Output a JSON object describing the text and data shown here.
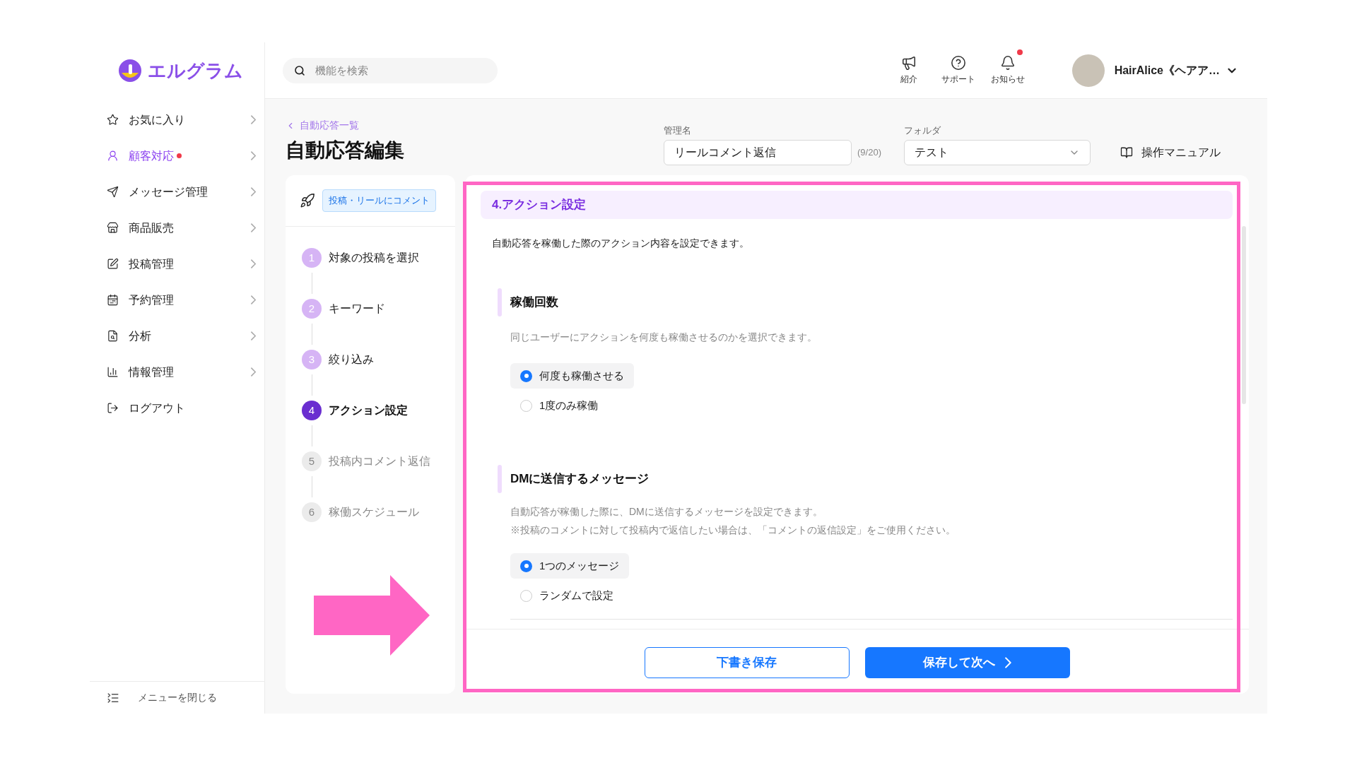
{
  "logo": {
    "text": "エルグラム"
  },
  "search": {
    "placeholder": "機能を検索"
  },
  "header_actions": [
    {
      "kind": "megaphone",
      "label": "紹介",
      "badge": false
    },
    {
      "kind": "help",
      "label": "サポート",
      "badge": false
    },
    {
      "kind": "bell",
      "label": "お知らせ",
      "badge": true
    }
  ],
  "account": {
    "name": "HairAlice《ヘアア…"
  },
  "sidebar": {
    "items": [
      {
        "label": "お気に入り",
        "selected": false,
        "dot": false,
        "submenu": true
      },
      {
        "label": "顧客対応",
        "selected": true,
        "dot": true,
        "submenu": true
      },
      {
        "label": "メッセージ管理",
        "selected": false,
        "dot": false,
        "submenu": true
      },
      {
        "label": "商品販売",
        "selected": false,
        "dot": false,
        "submenu": true
      },
      {
        "label": "投稿管理",
        "selected": false,
        "dot": false,
        "submenu": true
      },
      {
        "label": "予約管理",
        "selected": false,
        "dot": false,
        "submenu": true
      },
      {
        "label": "分析",
        "selected": false,
        "dot": false,
        "submenu": true
      },
      {
        "label": "情報管理",
        "selected": false,
        "dot": false,
        "submenu": true
      },
      {
        "label": "ログアウト",
        "selected": false,
        "dot": false,
        "submenu": false
      }
    ],
    "collapse": "メニューを閉じる"
  },
  "page": {
    "breadcrumb": "自動応答一覧",
    "title": "自動応答編集",
    "name_field": {
      "label": "管理名",
      "value": "リールコメント返信",
      "counter": "(9/20)"
    },
    "folder_field": {
      "label": "フォルダ",
      "value": "テスト"
    },
    "manual_link": "操作マニュアル"
  },
  "steps_panel": {
    "trigger_tag": "投稿・リールにコメント",
    "steps": [
      {
        "number": "1",
        "label": "対象の投稿を選択",
        "selected": false
      },
      {
        "number": "2",
        "label": "キーワード",
        "selected": false
      },
      {
        "number": "3",
        "label": "絞り込み",
        "selected": false
      },
      {
        "number": "4",
        "label": "アクション設定",
        "selected": true
      },
      {
        "number": "5",
        "label": "投稿内コメント返信",
        "selected": false
      },
      {
        "number": "6",
        "label": "稼働スケジュール",
        "selected": false
      }
    ]
  },
  "section": {
    "title": "4.アクション設定",
    "description": "自動応答を稼働した際のアクション内容を設定できます。",
    "groups": [
      {
        "title": "稼働回数",
        "help": [
          "同じユーザーにアクションを何度も稼働させるのかを選択できます。"
        ],
        "options": [
          {
            "label": "何度も稼働させる",
            "selected": true
          },
          {
            "label": "1度のみ稼働",
            "selected": false
          }
        ]
      },
      {
        "title": "DMに送信するメッセージ",
        "help": [
          "自動応答が稼働した際に、DMに送信するメッセージを設定できます。",
          "※投稿のコメントに対して投稿内で返信したい場合は、「コメントの返信設定」をご使用ください。"
        ],
        "options": [
          {
            "label": "1つのメッセージ",
            "selected": true
          },
          {
            "label": "ランダムで設定",
            "selected": false
          }
        ]
      }
    ]
  },
  "footer": {
    "buttons": [
      {
        "kind": "secondary",
        "label": "下書き保存"
      },
      {
        "kind": "primary",
        "label": "保存して次へ"
      }
    ]
  }
}
